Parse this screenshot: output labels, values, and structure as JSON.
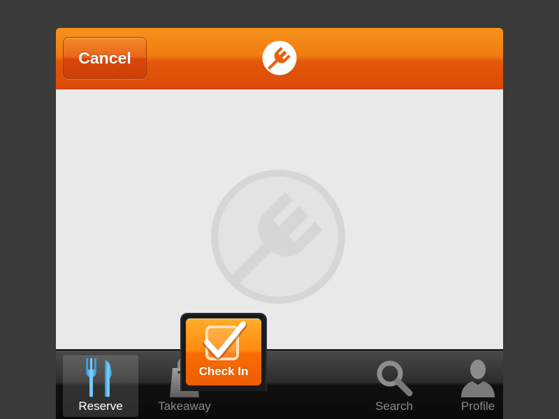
{
  "navbar": {
    "cancel_label": "Cancel",
    "logo_icon": "fork-logo-icon",
    "colors": {
      "top": "#f7921c",
      "bottom": "#dc4a06"
    }
  },
  "content": {
    "watermark_icon": "fork-logo-watermark-icon",
    "background": "#e9e9e9"
  },
  "tabbar": {
    "tabs": [
      {
        "label": "Reserve",
        "icon": "fork-knife-icon",
        "selected": true
      },
      {
        "label": "Takeaway",
        "icon": "shopping-bag-icon",
        "selected": false
      },
      {
        "label": "Check In",
        "icon": "checkmark-icon",
        "selected": false,
        "highlighted": true
      },
      {
        "label": "Search",
        "icon": "magnifier-icon",
        "selected": false
      },
      {
        "label": "Profile",
        "icon": "person-icon",
        "selected": false
      }
    ]
  },
  "colors": {
    "accent": "#f07d10",
    "reserve_icon_blue": "#35b6f0",
    "inactive_tab": "#8a8a8a"
  }
}
